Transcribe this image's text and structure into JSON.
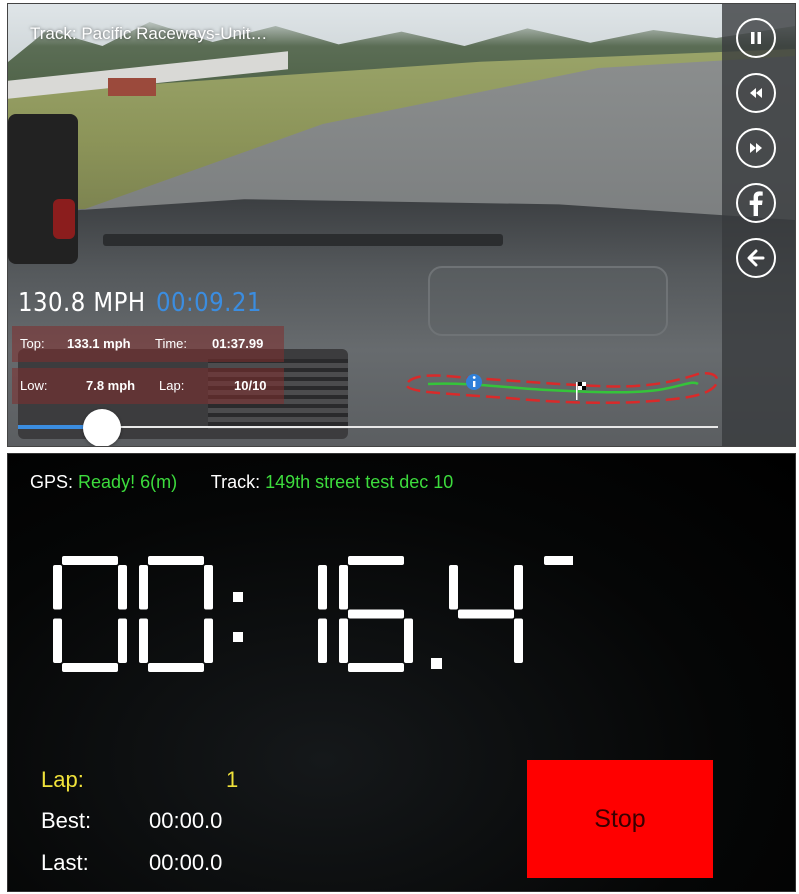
{
  "video": {
    "track_label": "Track:  Pacific Raceways-Unit…",
    "speed": "130.8 MPH",
    "elapsed": "00:09.21",
    "stats": {
      "top_label": "Top:",
      "top_value": "133.1 mph",
      "time_label": "Time:",
      "time_value": "01:37.99",
      "low_label": "Low:",
      "low_value": "7.8 mph",
      "lap_label": "Lap:",
      "lap_value": "10/10"
    },
    "controls": [
      "pause-icon",
      "rewind-icon",
      "fast-forward-icon",
      "facebook-icon",
      "back-arrow-icon"
    ],
    "progress": 0.12,
    "accent_color": "#3b8de0"
  },
  "timer": {
    "gps_label": "GPS:",
    "gps_value": "Ready! 6(m)",
    "track_label": "Track:",
    "track_value": "149th street test dec 10",
    "clock": "00:16.47",
    "lap_label": "Lap:",
    "lap_value": "1",
    "best_label": "Best:",
    "best_value": "00:00.0",
    "last_label": "Last:",
    "last_value": "00:00.0",
    "stop_label": "Stop",
    "status_color": "#3ddc3d",
    "lap_color": "#f0e23a",
    "stop_color": "#ff0000"
  }
}
